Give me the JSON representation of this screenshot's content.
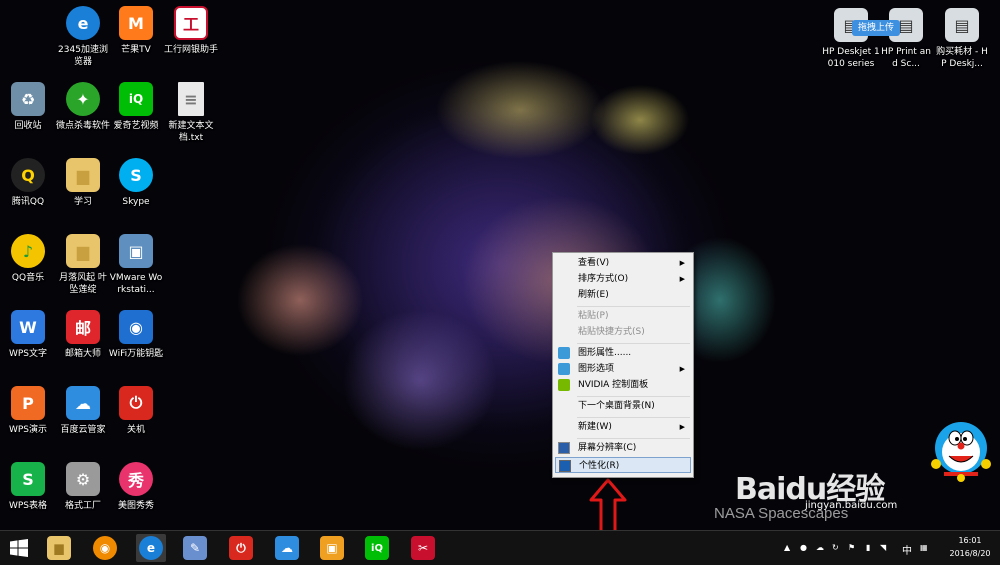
{
  "desktop_icons": [
    {
      "label": "2345加速浏览器",
      "glyph": "e",
      "color": "#1a7fd6"
    },
    {
      "label": "芒果TV",
      "glyph": "M",
      "color": "#ff7a1a"
    },
    {
      "label": "工行网银助手",
      "glyph": "工",
      "color": "#c8102e"
    },
    {
      "label": "回收站",
      "glyph": "♻",
      "color": "#6f8fa8"
    },
    {
      "label": "微点杀毒软件",
      "glyph": "✦",
      "color": "#2aa52a"
    },
    {
      "label": "爱奇艺视频",
      "glyph": "iQ",
      "color": "#00be06"
    },
    {
      "label": "新建文本文档.txt",
      "glyph": "≡",
      "color": "#e9e9e9"
    },
    {
      "label": "腾讯QQ",
      "glyph": "Q",
      "color": "#222222"
    },
    {
      "label": "学习",
      "glyph": "▆",
      "color": "#e8c46a"
    },
    {
      "label": "Skype",
      "glyph": "S",
      "color": "#00aff0"
    },
    {
      "label": "QQ音乐",
      "glyph": "♪",
      "color": "#f5c400"
    },
    {
      "label": "月落风起 叶坠莲绽",
      "glyph": "▆",
      "color": "#e8c46a"
    },
    {
      "label": "VMware Workstati...",
      "glyph": "▣",
      "color": "#5e8fbf"
    },
    {
      "label": "WPS文字",
      "glyph": "W",
      "color": "#2d79e0"
    },
    {
      "label": "邮箱大师",
      "glyph": "邮",
      "color": "#e0262d"
    },
    {
      "label": "WiFi万能钥匙",
      "glyph": "◉",
      "color": "#1e6fd0"
    },
    {
      "label": "WPS演示",
      "glyph": "P",
      "color": "#f06a24"
    },
    {
      "label": "百度云管家",
      "glyph": "☁",
      "color": "#2f8de0"
    },
    {
      "label": "关机",
      "glyph": "⏻",
      "color": "#d9281e"
    },
    {
      "label": "WPS表格",
      "glyph": "S",
      "color": "#17b24a"
    },
    {
      "label": "格式工厂",
      "glyph": "⚙",
      "color": "#9a9a9a"
    },
    {
      "label": "美图秀秀",
      "glyph": "秀",
      "color": "#e8336d"
    }
  ],
  "top_right_icons": [
    {
      "label": "HP Deskjet 1010 series",
      "glyph": "▤"
    },
    {
      "label": "HP Print and Sc...",
      "glyph": "▤"
    },
    {
      "label": "购买耗材 - HP Deskj...",
      "glyph": "▤"
    }
  ],
  "upload_tooltip": "拖拽上传",
  "context_menu": {
    "items": [
      {
        "label": "查看(V)",
        "submenu": true,
        "disabled": false,
        "icon": ""
      },
      {
        "label": "排序方式(O)",
        "submenu": true,
        "disabled": false,
        "icon": ""
      },
      {
        "label": "刷新(E)",
        "submenu": false,
        "disabled": false,
        "icon": ""
      },
      {
        "label": "粘贴(P)",
        "submenu": false,
        "disabled": true,
        "icon": ""
      },
      {
        "label": "粘贴快捷方式(S)",
        "submenu": false,
        "disabled": true,
        "icon": ""
      },
      {
        "label": "图形属性......",
        "submenu": false,
        "disabled": false,
        "icon": "intel-graphics-icon"
      },
      {
        "label": "图形选项",
        "submenu": true,
        "disabled": false,
        "icon": "intel-graphics-icon"
      },
      {
        "label": "NVIDIA 控制面板",
        "submenu": false,
        "disabled": false,
        "icon": "nvidia-icon"
      },
      {
        "label": "下一个桌面背景(N)",
        "submenu": false,
        "disabled": false,
        "icon": ""
      },
      {
        "label": "新建(W)",
        "submenu": true,
        "disabled": false,
        "icon": ""
      },
      {
        "label": "屏幕分辨率(C)",
        "submenu": false,
        "disabled": false,
        "icon": "display-icon"
      },
      {
        "label": "个性化(R)",
        "submenu": false,
        "disabled": false,
        "icon": "personalize-icon",
        "highlighted": true
      }
    ]
  },
  "taskbar": {
    "apps": [
      {
        "name": "file-explorer-icon",
        "glyph": "▆",
        "color": "#e8c46a"
      },
      {
        "name": "wifi-key-icon",
        "glyph": "◉",
        "color": "#f08a00"
      },
      {
        "name": "browser-icon",
        "glyph": "e",
        "color": "#1a7fd6"
      },
      {
        "name": "paint-icon",
        "glyph": "✎",
        "color": "#6a8fcf"
      },
      {
        "name": "shutdown-icon",
        "glyph": "⏻",
        "color": "#d9281e"
      },
      {
        "name": "baidu-cloud-icon",
        "glyph": "☁",
        "color": "#2f8de0"
      },
      {
        "name": "vmware-icon",
        "glyph": "▣",
        "color": "#f0a020"
      },
      {
        "name": "iqiyi-icon",
        "glyph": "iQ",
        "color": "#00be06"
      },
      {
        "name": "tool-icon",
        "glyph": "✂",
        "color": "#c8102e"
      }
    ],
    "tray": {
      "ime": "中",
      "time": "16:01",
      "date": "2016/8/20"
    }
  },
  "watermark": {
    "brand": "Baidu经验",
    "url": "jingyan.baidu.com",
    "nasa": "NASA Spacescapes"
  }
}
